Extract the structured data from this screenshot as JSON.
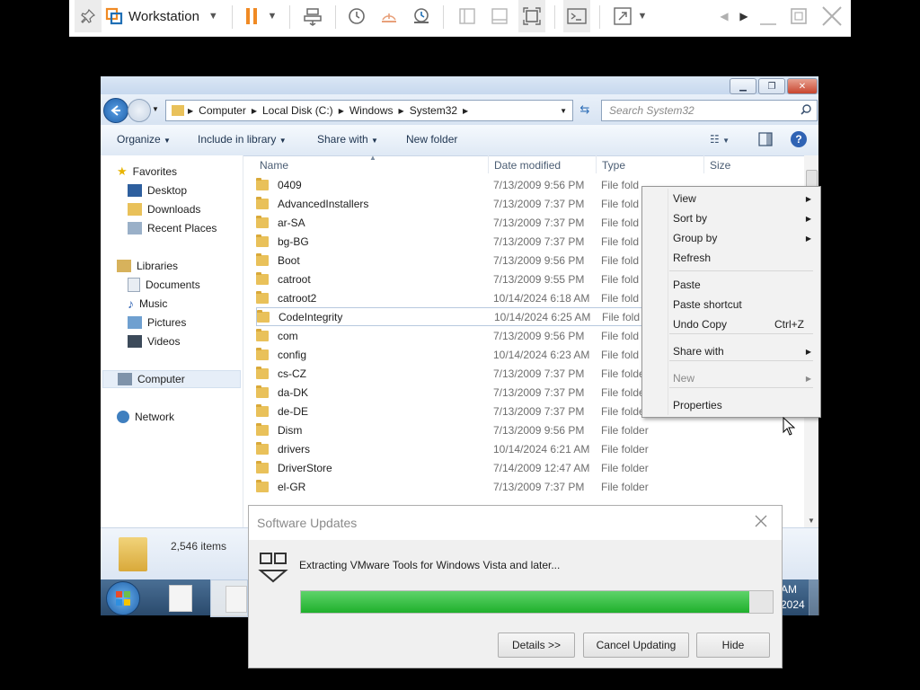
{
  "vmware": {
    "app_label": "Workstation"
  },
  "explorer": {
    "breadcrumbs": [
      "Computer",
      "Local Disk (C:)",
      "Windows",
      "System32"
    ],
    "search_placeholder": "Search System32",
    "commands": [
      "Organize",
      "Include in library",
      "Share with",
      "New folder"
    ],
    "nav": {
      "favorites": "Favorites",
      "favorites_items": [
        "Desktop",
        "Downloads",
        "Recent Places"
      ],
      "libraries": "Libraries",
      "libraries_items": [
        "Documents",
        "Music",
        "Pictures",
        "Videos"
      ],
      "computer": "Computer",
      "network": "Network"
    },
    "columns": [
      "Name",
      "Date modified",
      "Type",
      "Size"
    ],
    "files": [
      {
        "name": "0409",
        "date": "7/13/2009 9:56 PM",
        "type": "File fold"
      },
      {
        "name": "AdvancedInstallers",
        "date": "7/13/2009 7:37 PM",
        "type": "File fold"
      },
      {
        "name": "ar-SA",
        "date": "7/13/2009 7:37 PM",
        "type": "File fold"
      },
      {
        "name": "bg-BG",
        "date": "7/13/2009 7:37 PM",
        "type": "File fold"
      },
      {
        "name": "Boot",
        "date": "7/13/2009 9:56 PM",
        "type": "File fold"
      },
      {
        "name": "catroot",
        "date": "7/13/2009 9:55 PM",
        "type": "File fold"
      },
      {
        "name": "catroot2",
        "date": "10/14/2024 6:18 AM",
        "type": "File fold"
      },
      {
        "name": "CodeIntegrity",
        "date": "10/14/2024 6:25 AM",
        "type": "File fold"
      },
      {
        "name": "com",
        "date": "7/13/2009 9:56 PM",
        "type": "File fold"
      },
      {
        "name": "config",
        "date": "10/14/2024 6:23 AM",
        "type": "File fold"
      },
      {
        "name": "cs-CZ",
        "date": "7/13/2009 7:37 PM",
        "type": "File folder"
      },
      {
        "name": "da-DK",
        "date": "7/13/2009 7:37 PM",
        "type": "File folder"
      },
      {
        "name": "de-DE",
        "date": "7/13/2009 7:37 PM",
        "type": "File folder"
      },
      {
        "name": "Dism",
        "date": "7/13/2009 9:56 PM",
        "type": "File folder"
      },
      {
        "name": "drivers",
        "date": "10/14/2024 6:21 AM",
        "type": "File folder"
      },
      {
        "name": "DriverStore",
        "date": "7/14/2009 12:47 AM",
        "type": "File folder"
      },
      {
        "name": "el-GR",
        "date": "7/13/2009 7:37 PM",
        "type": "File folder"
      }
    ],
    "status_items": "2,546 items",
    "clock_line1": "AM",
    "clock_line2": "2024"
  },
  "context_menu": {
    "items": [
      {
        "label": "View",
        "shortcut": "",
        "submenu": true,
        "disabled": false
      },
      {
        "label": "Sort by",
        "shortcut": "",
        "submenu": true,
        "disabled": false
      },
      {
        "label": "Group by",
        "shortcut": "",
        "submenu": true,
        "disabled": false
      },
      {
        "label": "Refresh",
        "shortcut": "",
        "submenu": false,
        "disabled": false
      },
      {
        "label": "Paste",
        "shortcut": "",
        "submenu": false,
        "disabled": false
      },
      {
        "label": "Paste shortcut",
        "shortcut": "",
        "submenu": false,
        "disabled": false
      },
      {
        "label": "Undo Copy",
        "shortcut": "Ctrl+Z",
        "submenu": false,
        "disabled": false
      },
      {
        "label": "Share with",
        "shortcut": "",
        "submenu": true,
        "disabled": false
      },
      {
        "label": "New",
        "shortcut": "",
        "submenu": true,
        "disabled": true
      },
      {
        "label": "Properties",
        "shortcut": "",
        "submenu": false,
        "disabled": false
      }
    ]
  },
  "dialog": {
    "title": "Software Updates",
    "message": "Extracting VMware Tools for Windows Vista and later...",
    "progress": 0.95,
    "buttons": [
      "Details >>",
      "Cancel Updating",
      "Hide"
    ]
  },
  "colors": {
    "progress_green": "#2fbf3a",
    "vmware_orange": "#f08a24"
  }
}
